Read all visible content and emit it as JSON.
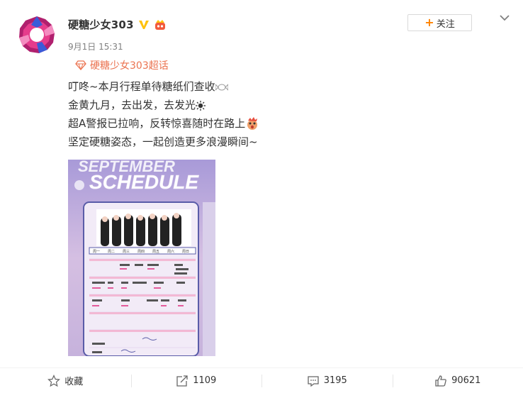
{
  "user": {
    "name": "硬糖少女303",
    "timestamp": "9月1日 15:31"
  },
  "follow_button": {
    "label": "关注"
  },
  "supertopic": {
    "label": "硬糖少女303超话"
  },
  "post_lines": [
    "叮咚~本月行程单待糖纸们查收",
    "金黄九月，去出发，去发光",
    "超A警报已拉响，反转惊喜随时在路上",
    "坚定硬糖姿态，一起创造更多浪漫瞬间~"
  ],
  "poster": {
    "title_top": "SEPTEMBER",
    "title_main": "SCHEDULE",
    "weekdays": [
      "周一",
      "周二",
      "周三",
      "周四",
      "周五",
      "周六",
      "周日"
    ]
  },
  "actions": {
    "favorite_label": "收藏",
    "share_count": "1109",
    "comment_count": "3195",
    "like_count": "90621"
  },
  "colors": {
    "accent": "#ff8200",
    "supertopic": "#eb7350",
    "verified": "#ffc20e",
    "avatar_magenta": "#b0206e",
    "avatar_blue": "#3a5bd9"
  }
}
